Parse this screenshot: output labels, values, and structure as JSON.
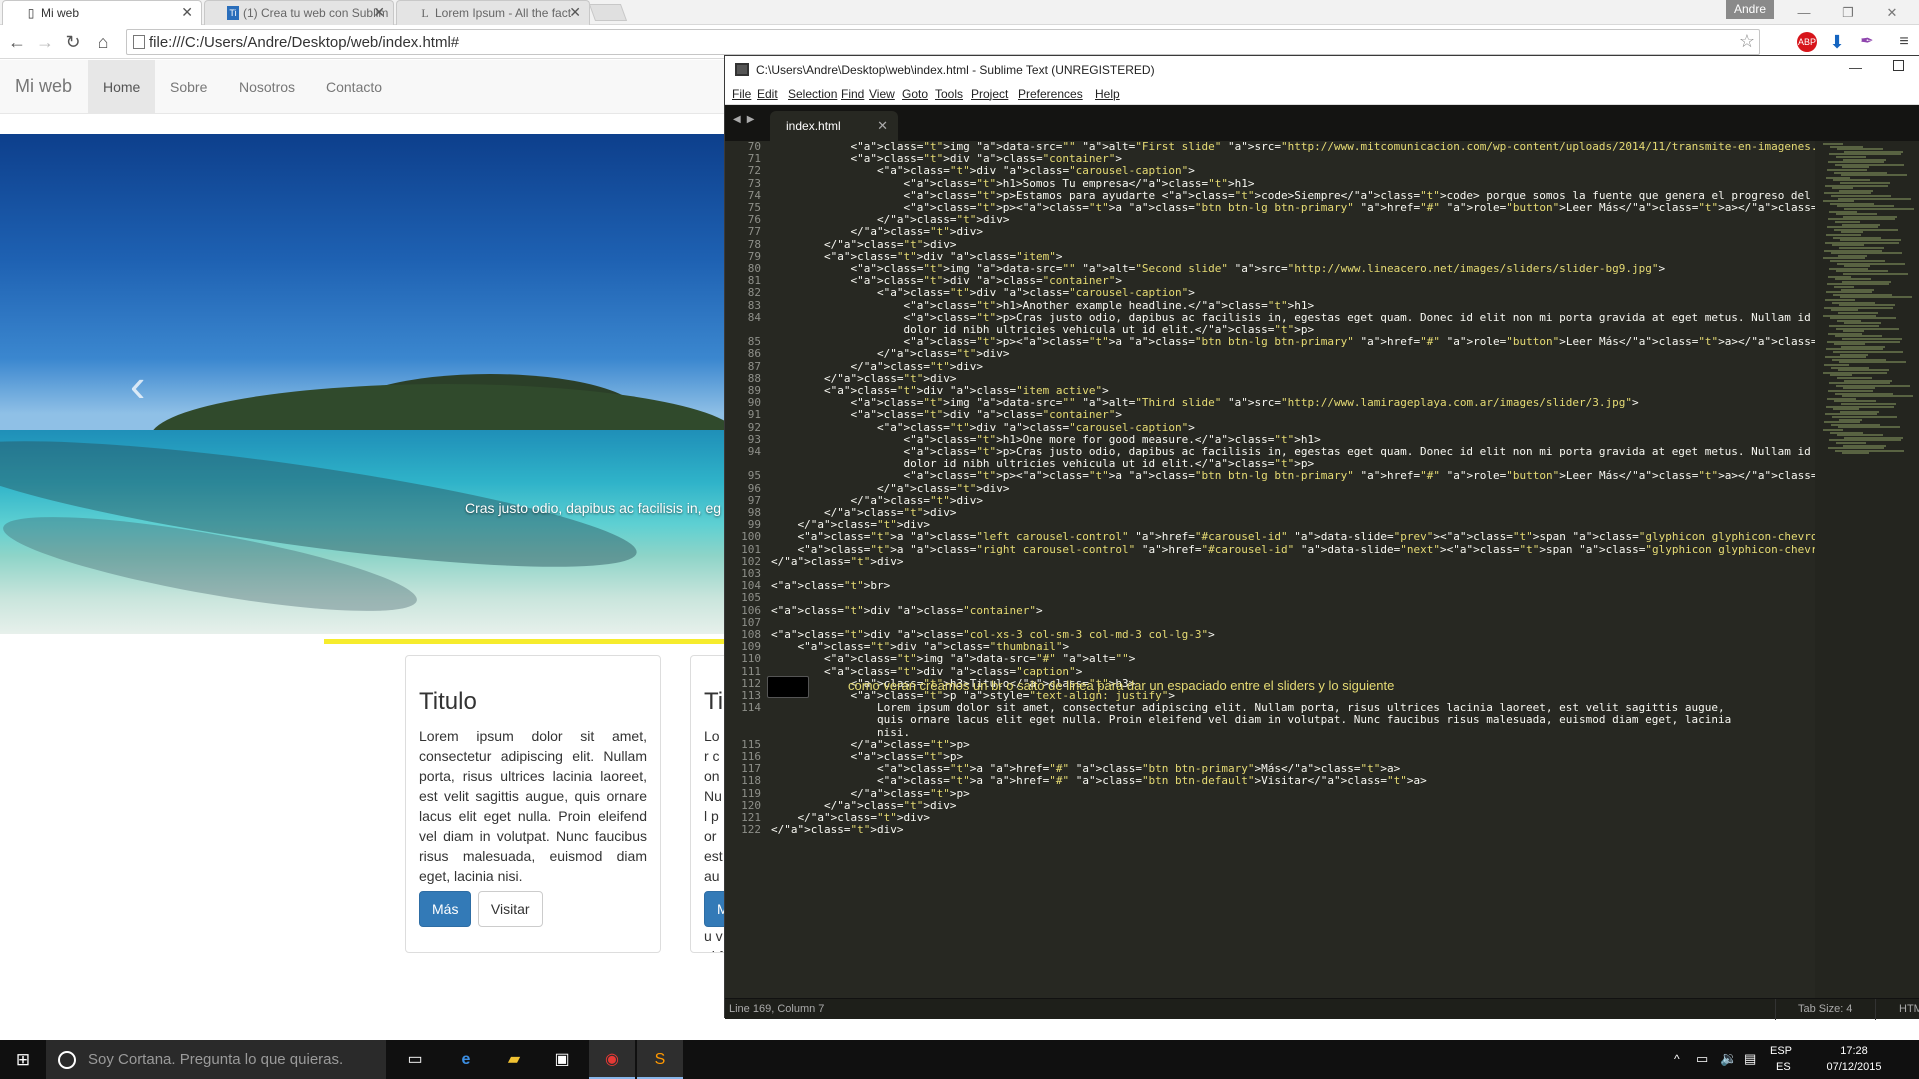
{
  "browser": {
    "tabs": [
      {
        "title": "Mi web",
        "icon": "page-icon",
        "active": true
      },
      {
        "title": "(1) Crea tu web con Sublim",
        "icon": "ti-icon",
        "active": false
      },
      {
        "title": "Lorem Ipsum - All the fact",
        "icon": "lorem-icon",
        "active": false
      }
    ],
    "profile": "Andre",
    "url": "file:///C:/Users/Andre/Desktop/web/index.html#",
    "extensions": [
      "ABP"
    ]
  },
  "site": {
    "brand": "Mi web",
    "nav": [
      "Home",
      "Sobre",
      "Nosotros",
      "Contacto"
    ],
    "carousel_caption": "Cras justo odio, dapibus ac facilisis in, eg",
    "cards": [
      {
        "title": "Titulo",
        "text": "Lorem ipsum dolor sit amet, consectetur adipiscing elit. Nullam porta, risus ultrices lacinia laoreet, est velit sagittis augue, quis ornare lacus elit eget nulla. Proin eleifend vel diam in volutpat. Nunc faucibus risus malesuada, euismod diam eget, lacinia nisi.",
        "primary_label": "Más",
        "default_label": "Visitar"
      },
      {
        "title": "Ti",
        "text": "Lor con Nul por est aug lacu vel faud eis eget",
        "primary_label": "M"
      }
    ]
  },
  "sublime": {
    "title": "C:\\Users\\Andre\\Desktop\\web\\index.html - Sublime Text (UNREGISTERED)",
    "menu": [
      "File",
      "Edit",
      "Selection",
      "Find",
      "View",
      "Goto",
      "Tools",
      "Project",
      "Preferences",
      "Help"
    ],
    "tab": "index.html",
    "annotation": "como veran creamos un  br o salto de linea para dar un espaciado entre el sliders y lo siguiente",
    "status_left": "Line 169, Column 7",
    "status_tab": "Tab Size: 4",
    "status_syntax": "HTML",
    "lines": [
      {
        "n": "70",
        "code": "            <img data-src=\"\" alt=\"First slide\" src=\"http://www.mitcomunicacion.com/wp-content/uploads/2014/11/transmite-en-imagenes.jpg\">"
      },
      {
        "n": "71",
        "code": "            <div class=\"container\">"
      },
      {
        "n": "72",
        "code": "                <div class=\"carousel-caption\">"
      },
      {
        "n": "73",
        "code": "                    <h1>Somos Tu empresa</h1>"
      },
      {
        "n": "74",
        "code": "                    <p>Estamos para ayudarte <code>Siempre</code> porque somos la fuente que genera el progreso del futuro, nuestro futuro..</p>"
      },
      {
        "n": "75",
        "code": "                    <p><a class=\"btn btn-lg btn-primary\" href=\"#\" role=\"button\">Leer Más</a></p>"
      },
      {
        "n": "76",
        "code": "                </div>"
      },
      {
        "n": "77",
        "code": "            </div>"
      },
      {
        "n": "78",
        "code": "        </div>"
      },
      {
        "n": "79",
        "code": "        <div class=\"item\">"
      },
      {
        "n": "80",
        "code": "            <img data-src=\"\" alt=\"Second slide\" src=\"http://www.lineacero.net/images/sliders/slider-bg9.jpg\">"
      },
      {
        "n": "81",
        "code": "            <div class=\"container\">"
      },
      {
        "n": "82",
        "code": "                <div class=\"carousel-caption\">"
      },
      {
        "n": "83",
        "code": "                    <h1>Another example headline.</h1>"
      },
      {
        "n": "84",
        "code": "                    <p>Cras justo odio, dapibus ac facilisis in, egestas eget quam. Donec id elit non mi porta gravida at eget metus. Nullam id"
      },
      {
        "n": "",
        "code": "                    dolor id nibh ultricies vehicula ut id elit.</p>"
      },
      {
        "n": "85",
        "code": "                    <p><a class=\"btn btn-lg btn-primary\" href=\"#\" role=\"button\">Leer Más</a></p>"
      },
      {
        "n": "86",
        "code": "                </div>"
      },
      {
        "n": "87",
        "code": "            </div>"
      },
      {
        "n": "88",
        "code": "        </div>"
      },
      {
        "n": "89",
        "code": "        <div class=\"item active\">"
      },
      {
        "n": "90",
        "code": "            <img data-src=\"\" alt=\"Third slide\" src=\"http://www.lamirageplaya.com.ar/images/slider/3.jpg\">"
      },
      {
        "n": "91",
        "code": "            <div class=\"container\">"
      },
      {
        "n": "92",
        "code": "                <div class=\"carousel-caption\">"
      },
      {
        "n": "93",
        "code": "                    <h1>One more for good measure.</h1>"
      },
      {
        "n": "94",
        "code": "                    <p>Cras justo odio, dapibus ac facilisis in, egestas eget quam. Donec id elit non mi porta gravida at eget metus. Nullam id"
      },
      {
        "n": "",
        "code": "                    dolor id nibh ultricies vehicula ut id elit.</p>"
      },
      {
        "n": "95",
        "code": "                    <p><a class=\"btn btn-lg btn-primary\" href=\"#\" role=\"button\">Leer Más</a></p>"
      },
      {
        "n": "96",
        "code": "                </div>"
      },
      {
        "n": "97",
        "code": "            </div>"
      },
      {
        "n": "98",
        "code": "        </div>"
      },
      {
        "n": "99",
        "code": "    </div>"
      },
      {
        "n": "100",
        "code": "    <a class=\"left carousel-control\" href=\"#carousel-id\" data-slide=\"prev\"><span class=\"glyphicon glyphicon-chevron-left\"></span></a>"
      },
      {
        "n": "101",
        "code": "    <a class=\"right carousel-control\" href=\"#carousel-id\" data-slide=\"next\"><span class=\"glyphicon glyphicon-chevron-right\"></span></a>"
      },
      {
        "n": "102",
        "code": "</div>"
      },
      {
        "n": "103",
        "code": ""
      },
      {
        "n": "104",
        "code": "<br>"
      },
      {
        "n": "105",
        "code": ""
      },
      {
        "n": "106",
        "code": "<div class=\"container\">"
      },
      {
        "n": "107",
        "code": ""
      },
      {
        "n": "108",
        "code": "<div class=\"col-xs-3 col-sm-3 col-md-3 col-lg-3\">"
      },
      {
        "n": "109",
        "code": "    <div class=\"thumbnail\">"
      },
      {
        "n": "110",
        "code": "        <img data-src=\"#\" alt=\"\">"
      },
      {
        "n": "111",
        "code": "        <div class=\"caption\">"
      },
      {
        "n": "112",
        "code": "            <h3>Titulo</h3>"
      },
      {
        "n": "113",
        "code": "            <p style=\"text-align: justify\">"
      },
      {
        "n": "114",
        "code": "                Lorem ipsum dolor sit amet, consectetur adipiscing elit. Nullam porta, risus ultrices lacinia laoreet, est velit sagittis augue,"
      },
      {
        "n": "",
        "code": "                quis ornare lacus elit eget nulla. Proin eleifend vel diam in volutpat. Nunc faucibus risus malesuada, euismod diam eget, lacinia"
      },
      {
        "n": "",
        "code": "                nisi."
      },
      {
        "n": "115",
        "code": "            </p>"
      },
      {
        "n": "116",
        "code": "            <p>"
      },
      {
        "n": "117",
        "code": "                <a href=\"#\" class=\"btn btn-primary\">Más</a>"
      },
      {
        "n": "118",
        "code": "                <a href=\"#\" class=\"btn btn-default\">Visitar</a>"
      },
      {
        "n": "119",
        "code": "            </p>"
      },
      {
        "n": "120",
        "code": "        </div>"
      },
      {
        "n": "121",
        "code": "    </div>"
      },
      {
        "n": "122",
        "code": "</div>"
      }
    ]
  },
  "taskbar": {
    "cortana": "Soy Cortana. Pregunta lo que quieras.",
    "lang_top": "ESP",
    "lang_bottom": "ES",
    "time": "17:28",
    "date": "07/12/2015"
  },
  "colors": {
    "sublime_bg": "#272822",
    "tag": "#f92672",
    "attr": "#a6e22e",
    "string": "#e6db74",
    "bootstrap_primary": "#337ab7",
    "highlight": "#f6ec2d"
  }
}
